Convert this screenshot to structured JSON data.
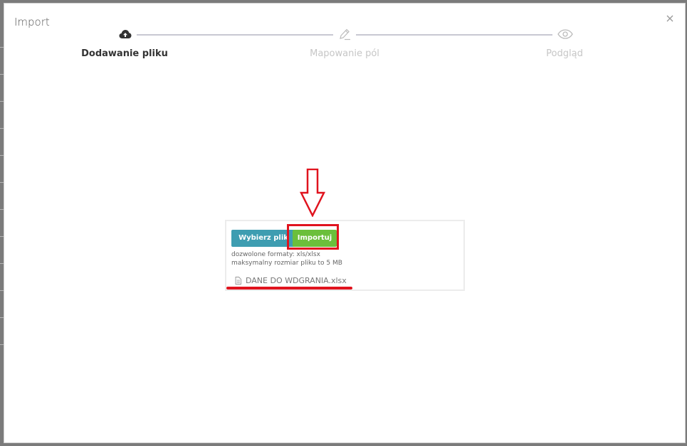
{
  "modal": {
    "title": "Import",
    "close_symbol": "×"
  },
  "stepper": {
    "steps": [
      {
        "label": "Dodawanie pliku",
        "icon": "cloud-upload-icon",
        "state": "active"
      },
      {
        "label": "Mapowanie pól",
        "icon": "pencil-icon",
        "state": "inactive"
      },
      {
        "label": "Podgląd",
        "icon": "eye-icon",
        "state": "inactive"
      }
    ]
  },
  "upload": {
    "choose_label": "Wybierz plik",
    "import_label": "Importuj",
    "formats_text": "dozwolone formaty: xls/xlsx",
    "max_size_text": "maksymalny rozmiar pliku to 5 MB",
    "file_name": "DANE DO WDGRANIA.xlsx"
  },
  "colors": {
    "choose_button": "#3e9db1",
    "import_button": "#6bbf3b",
    "annotation": "#e0131e"
  }
}
